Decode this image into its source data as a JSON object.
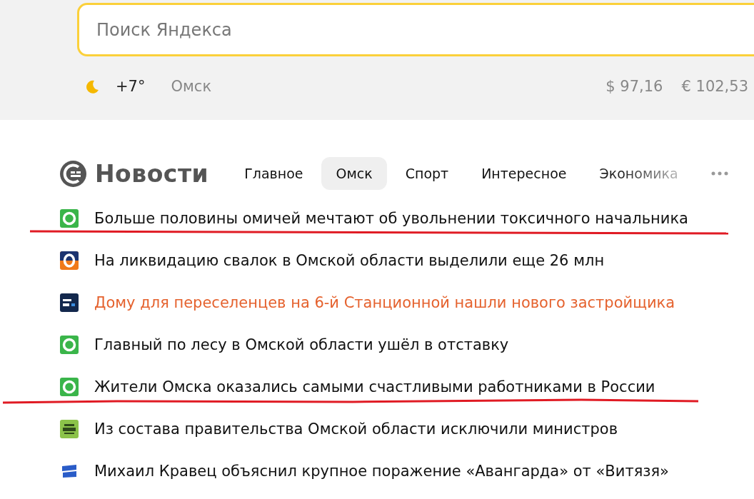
{
  "search": {
    "placeholder": "Поиск Яндекса"
  },
  "weather": {
    "temperature": "+7°",
    "city": "Омск"
  },
  "rates": [
    "$ 97,16",
    "€ 102,53"
  ],
  "news": {
    "title": "Новости",
    "tabs": [
      {
        "label": "Главное",
        "selected": false,
        "faded": false
      },
      {
        "label": "Омск",
        "selected": true,
        "faded": false
      },
      {
        "label": "Спорт",
        "selected": false,
        "faded": false
      },
      {
        "label": "Интересное",
        "selected": false,
        "faded": false
      },
      {
        "label": "Экономика",
        "selected": false,
        "faded": true
      }
    ],
    "items": [
      {
        "kind": "green",
        "text": "Больше половины омичей мечтают об увольнении токсичного начальника",
        "visited": false,
        "underlined": true
      },
      {
        "kind": "blue-orange",
        "text": "На ликвидацию свалок в Омской области выделили еще 26 млн",
        "visited": false,
        "underlined": false
      },
      {
        "kind": "navy",
        "text": "Дому для переселенцев на 6-й Станционной нашли нового застройщика",
        "visited": true,
        "underlined": false
      },
      {
        "kind": "green",
        "text": "Главный по лесу в Омской области ушёл в отставку",
        "visited": false,
        "underlined": false
      },
      {
        "kind": "green",
        "text": "Жители Омска оказались самыми счастливыми работниками в России",
        "visited": false,
        "underlined": true
      },
      {
        "kind": "lime",
        "text": "Из состава правительства Омской области исключили министров",
        "visited": false,
        "underlined": false
      },
      {
        "kind": "white-blue",
        "text": "Михаил Кравец объяснил крупное поражение «Авангарда» от «Витязя»",
        "visited": false,
        "underlined": false
      }
    ]
  }
}
